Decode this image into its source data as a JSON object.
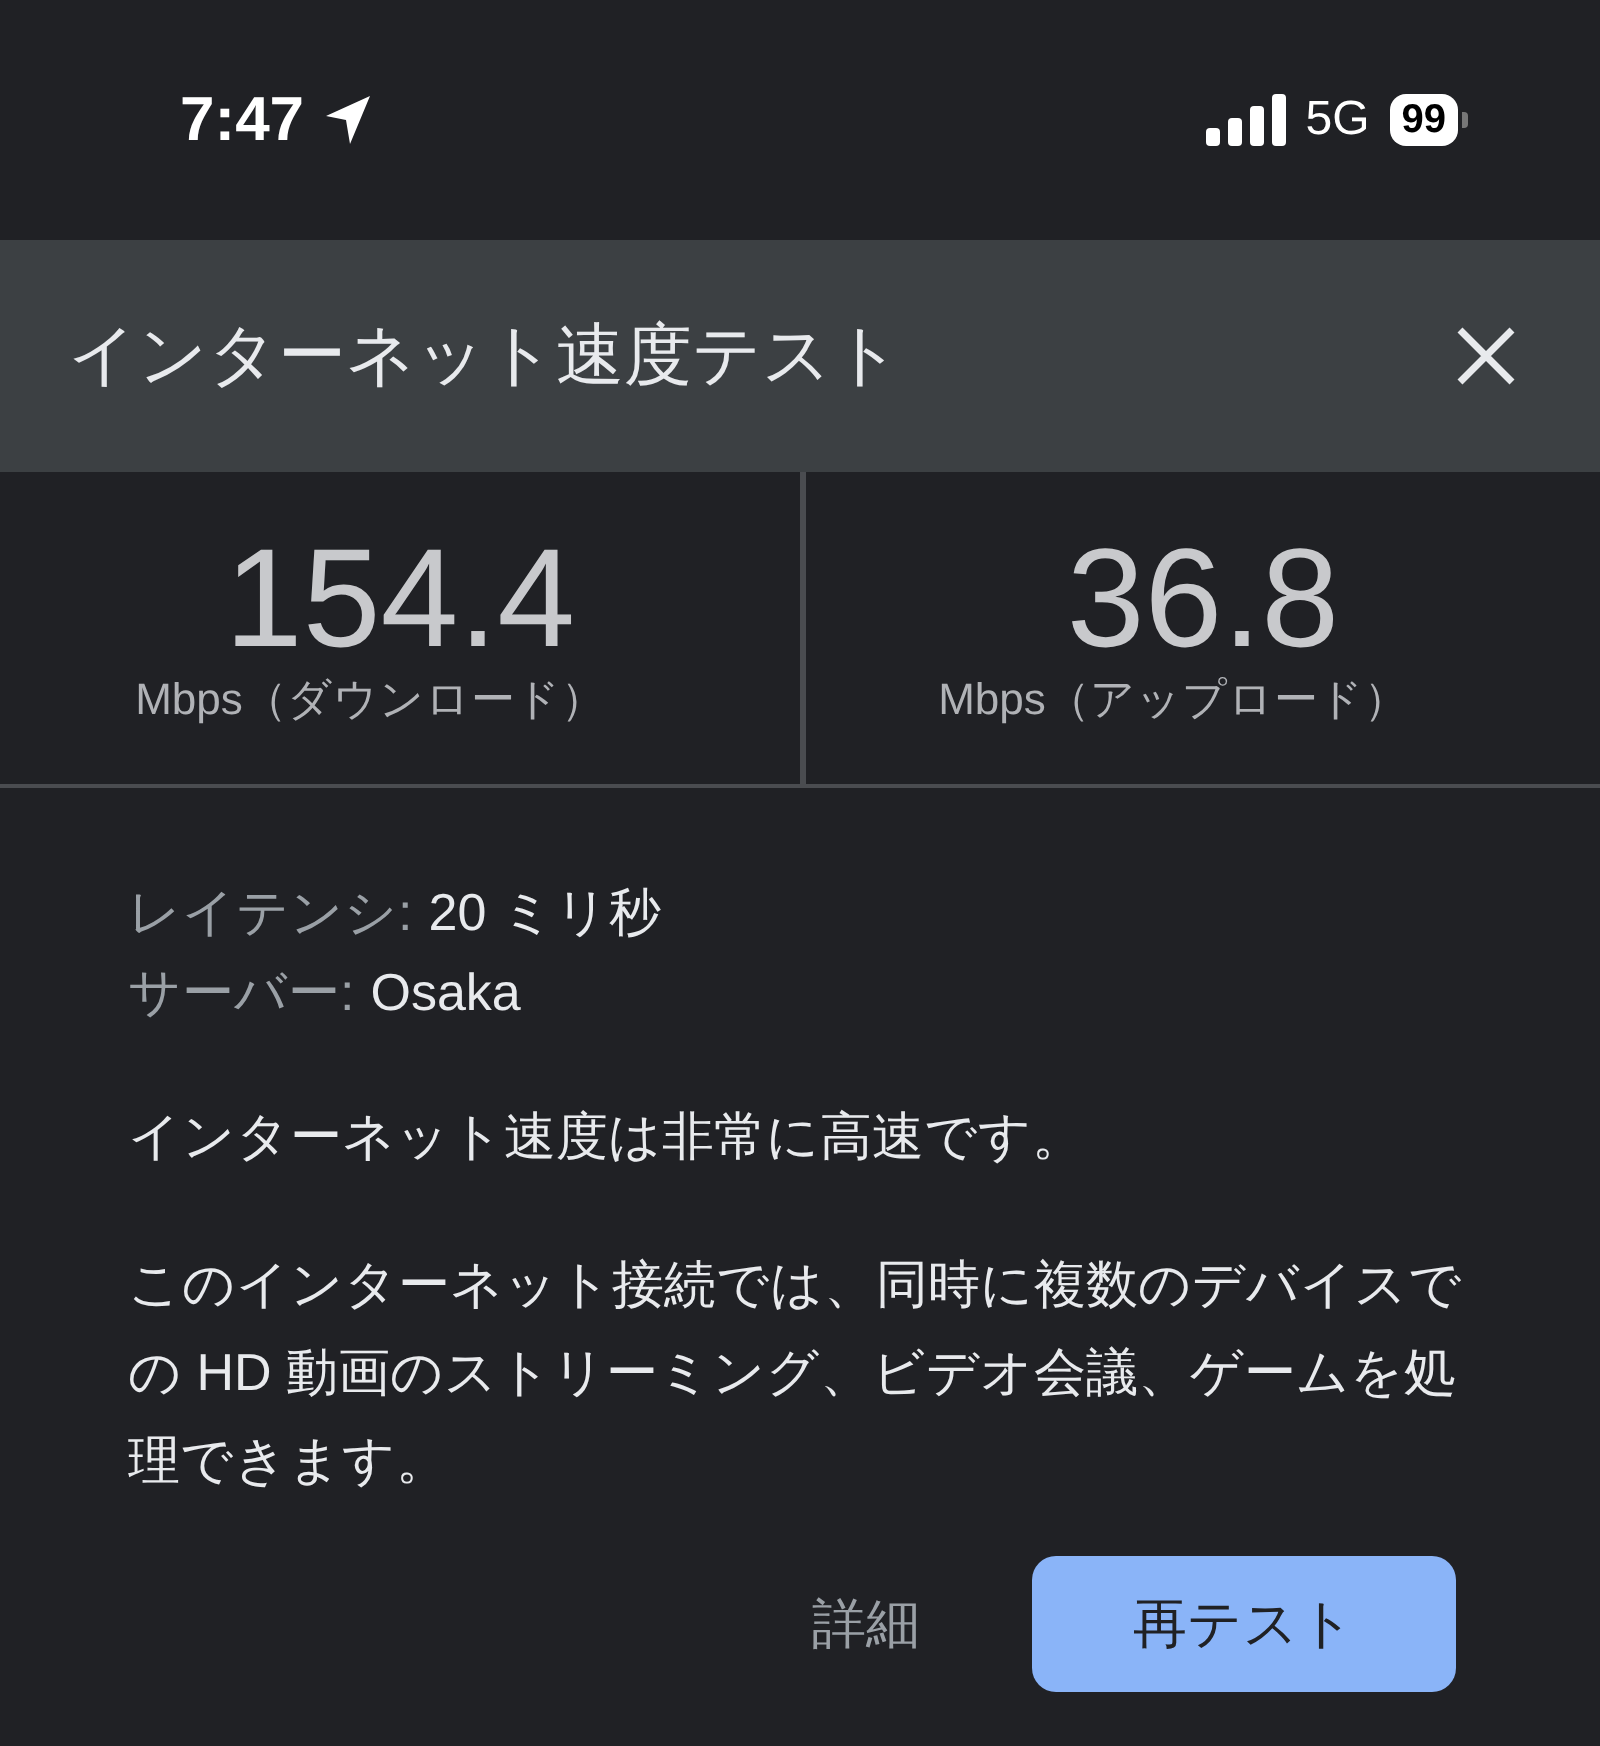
{
  "status_bar": {
    "time": "7:47",
    "network": "5G",
    "battery": "99"
  },
  "header": {
    "title": "インターネット速度テスト"
  },
  "metrics": [
    {
      "value": "154.4",
      "unit": "Mbps（ダウンロード）"
    },
    {
      "value": "36.8",
      "unit": "Mbps（アップロード）"
    }
  ],
  "details": [
    {
      "label": "レイテンシ:",
      "value": "20 ミリ秒"
    },
    {
      "label": "サーバー:",
      "value": "Osaka"
    }
  ],
  "summary": "インターネット速度は非常に高速です。",
  "description": "このインターネット接続では、同時に複数のデバイスでの HD 動画のストリーミング、ビデオ会議、ゲームを処理できます。",
  "buttons": [
    {
      "label": "詳細",
      "kind": "text"
    },
    {
      "label": "再テスト",
      "kind": "filled"
    }
  ]
}
